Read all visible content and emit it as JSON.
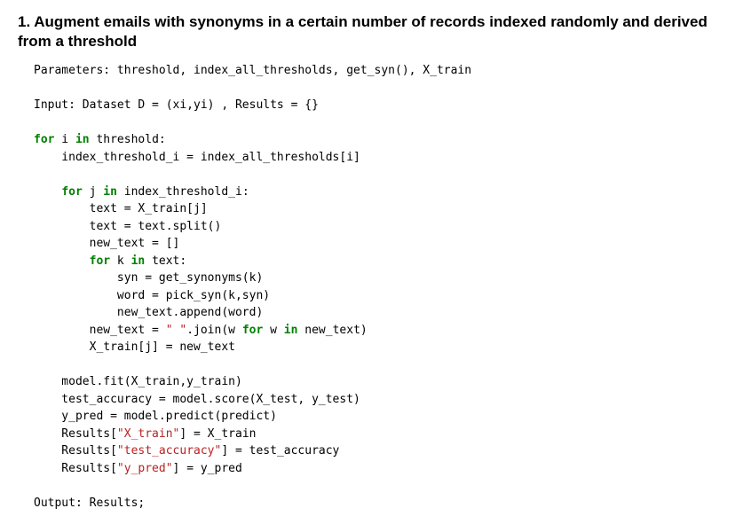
{
  "heading": "1. Augment emails with synonyms in a certain number of records indexed randomly and derived from a threshold",
  "code": {
    "params": "Parameters: threshold, index_all_thresholds, get_syn(), X_train",
    "input": "Input: Dataset D = (xi,yi) , Results = {}",
    "kw_for": "for",
    "kw_in": "in",
    "l1a": " i ",
    "l1b": " threshold:",
    "l2": "    index_threshold_i = index_all_thresholds[i]",
    "l3a": "    ",
    "l3b": " j ",
    "l3c": " index_threshold_i:",
    "l4": "        text = X_train[j]",
    "l5": "        text = text.split()",
    "l6": "        new_text = []",
    "l7a": "        ",
    "l7b": " k ",
    "l7c": " text:",
    "l8": "            syn = get_synonyms(k)",
    "l9": "            word = pick_syn(k,syn)",
    "l10": "            new_text.append(word)",
    "l11a": "        new_text = ",
    "l11_str": "\" \"",
    "l11b": ".join(w ",
    "l11c": " w ",
    "l11d": " new_text)",
    "l12": "        X_train[j] = new_text",
    "l13": "    model.fit(X_train,y_train)",
    "l14": "    test_accuracy = model.score(X_test, y_test)",
    "l15": "    y_pred = model.predict(predict)",
    "l16a": "    Results[",
    "l16_str": "\"X_train\"",
    "l16b": "] = X_train",
    "l17a": "    Results[",
    "l17_str": "\"test_accuracy\"",
    "l17b": "] = test_accuracy",
    "l18a": "    Results[",
    "l18_str": "\"y_pred\"",
    "l18b": "] = y_pred",
    "output": "Output: Results;"
  }
}
